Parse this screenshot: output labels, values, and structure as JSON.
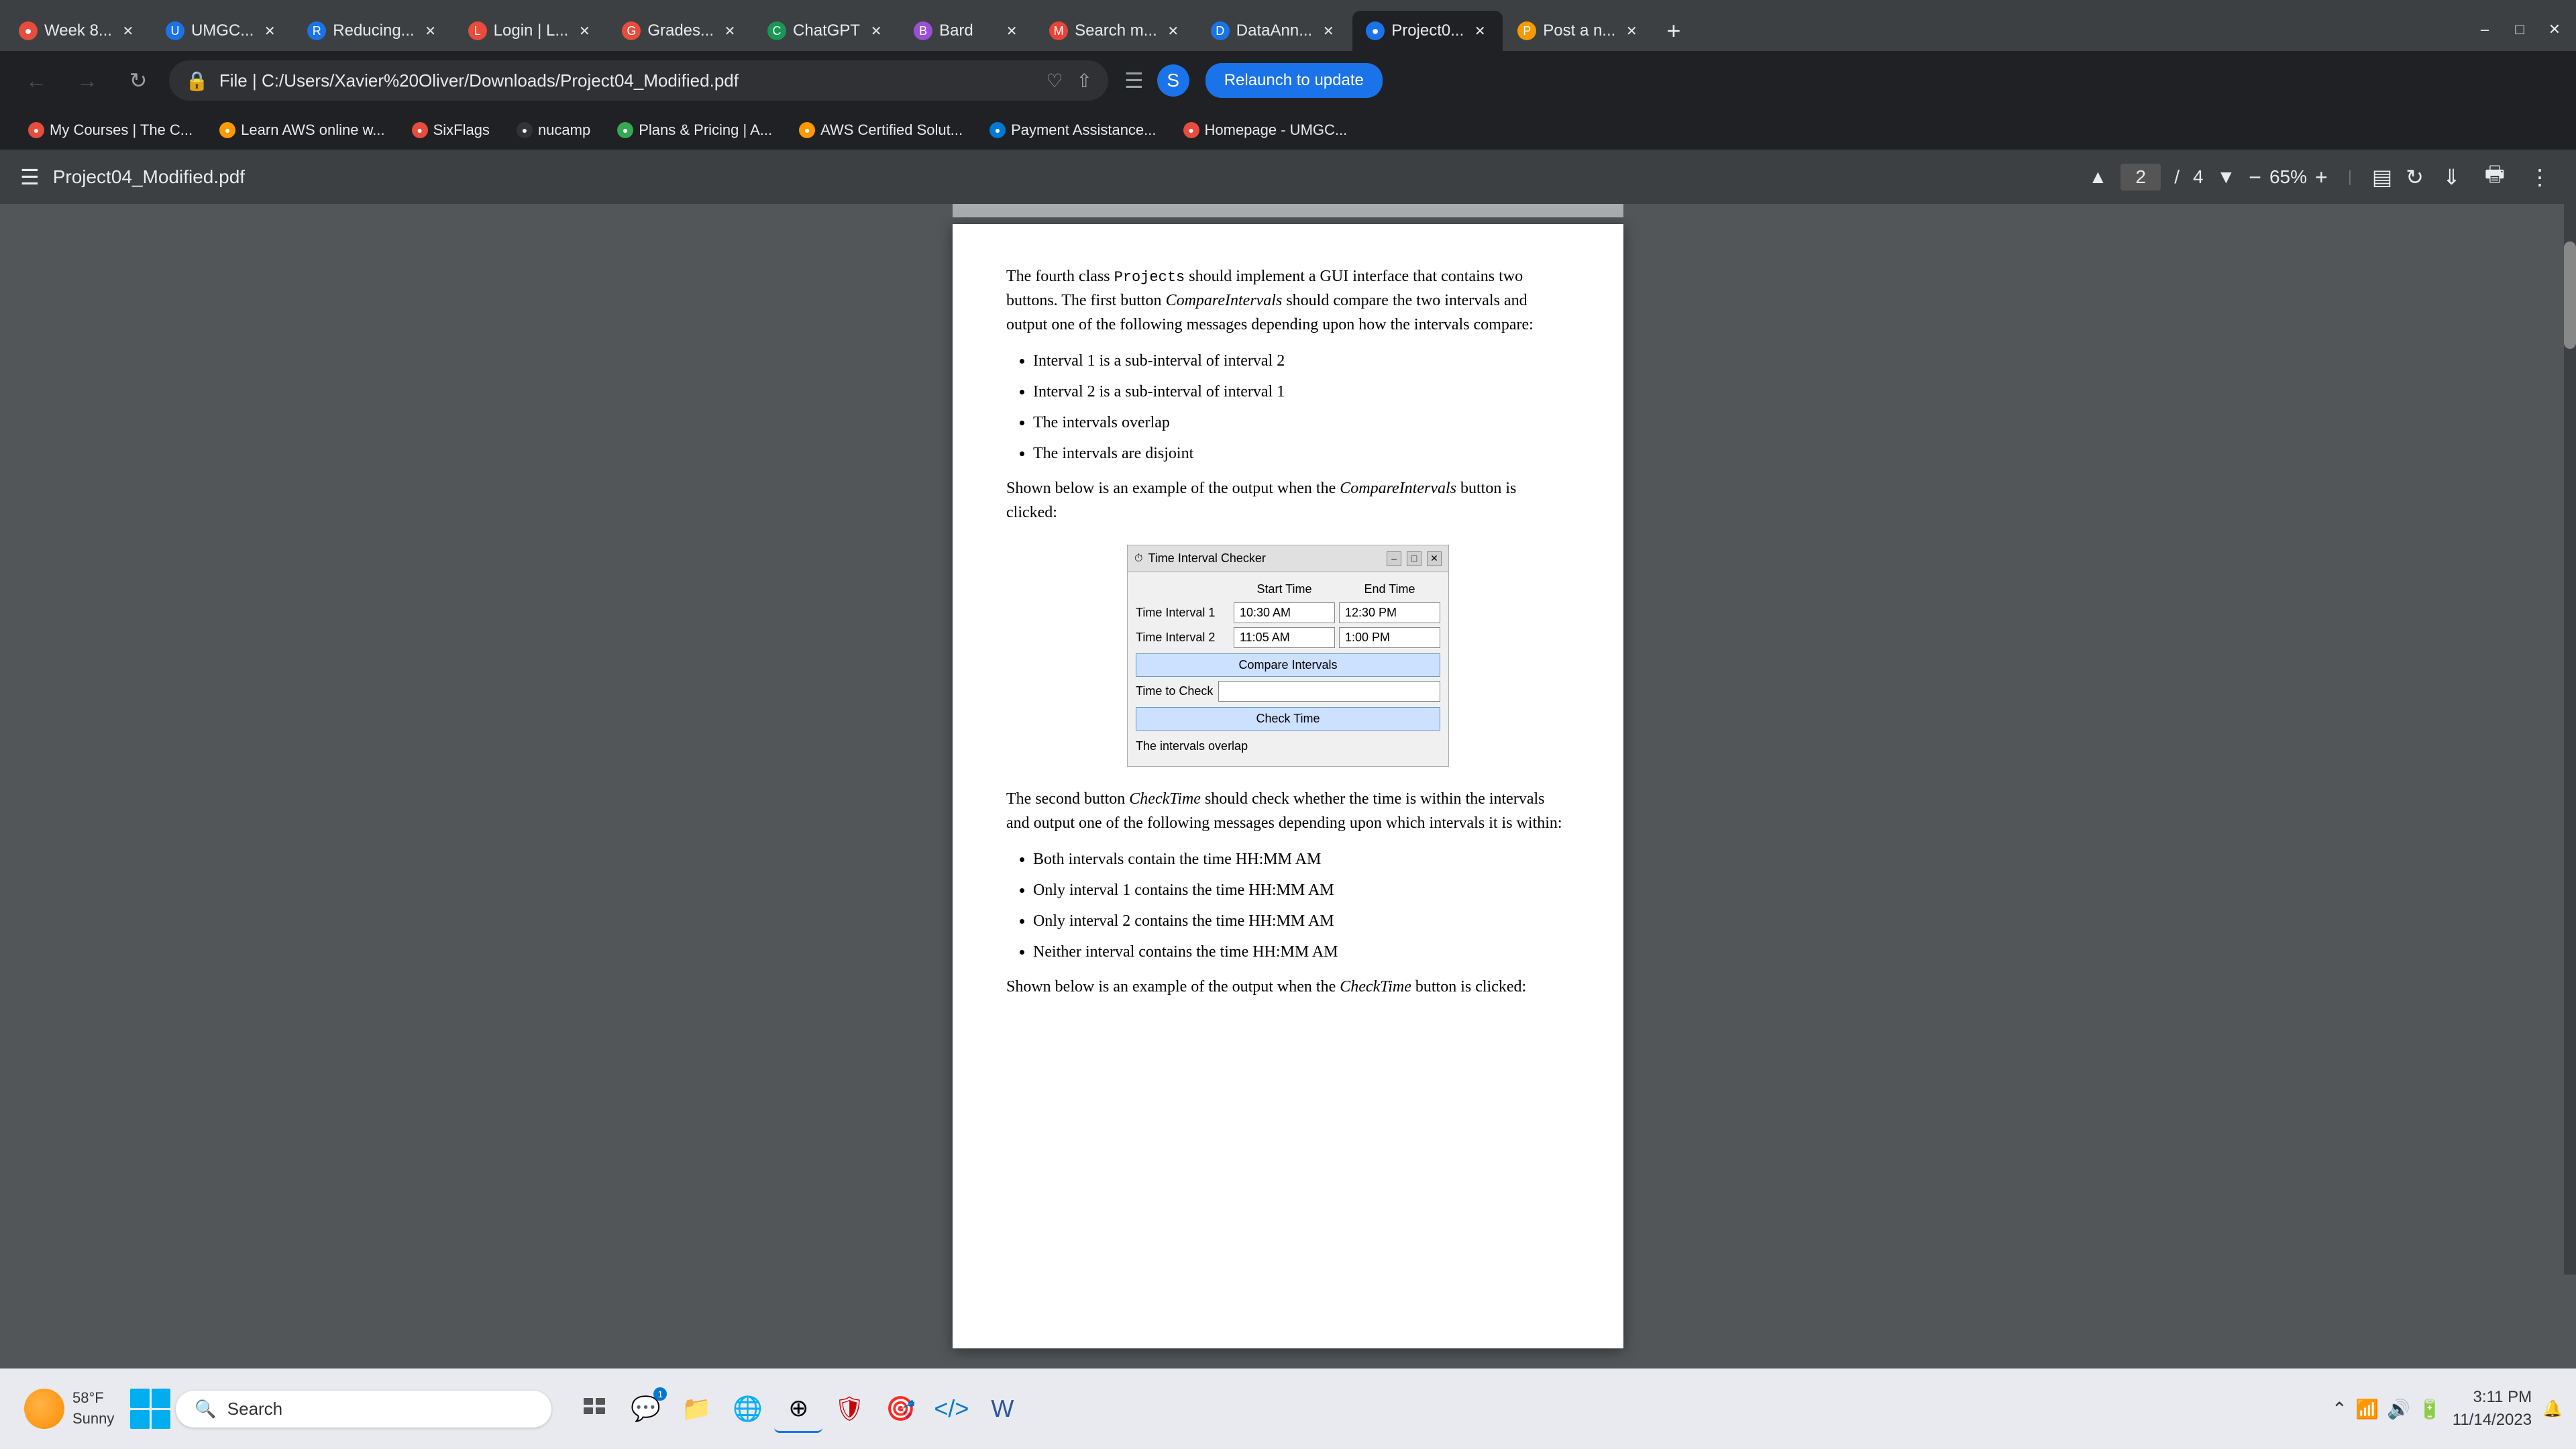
{
  "browser": {
    "tabs": [
      {
        "id": "week8",
        "label": "Week 8...",
        "favicon_color": "#e74c3c",
        "favicon_char": "●",
        "active": false
      },
      {
        "id": "umgc",
        "label": "UMGC...",
        "favicon_color": "#1a73e8",
        "favicon_char": "U",
        "active": false
      },
      {
        "id": "reducing",
        "label": "Reducing...",
        "favicon_color": "#1a73e8",
        "favicon_char": "R",
        "active": false
      },
      {
        "id": "login",
        "label": "Login | L...",
        "favicon_color": "#e74c3c",
        "favicon_char": "L",
        "active": false
      },
      {
        "id": "grades",
        "label": "Grades...",
        "favicon_color": "#e74c3c",
        "favicon_char": "G",
        "active": false
      },
      {
        "id": "chatgpt",
        "label": "ChatGPT",
        "favicon_color": "#1a9655",
        "favicon_char": "C",
        "active": false
      },
      {
        "id": "bard",
        "label": "Bard",
        "favicon_color": "#9c4fd6",
        "favicon_char": "B",
        "active": false
      },
      {
        "id": "search_mail",
        "label": "Search m...",
        "favicon_color": "#ea4335",
        "favicon_char": "M",
        "active": false
      },
      {
        "id": "dataann",
        "label": "DataAnn...",
        "favicon_color": "#1a73e8",
        "favicon_char": "D",
        "active": false
      },
      {
        "id": "project0",
        "label": "Project0...",
        "favicon_color": "#1a73e8",
        "favicon_char": "●",
        "active": true
      },
      {
        "id": "post",
        "label": "Post a n...",
        "favicon_color": "#f59b00",
        "favicon_char": "P",
        "active": false
      }
    ],
    "address": {
      "icon": "🔒",
      "url": "File  |  C:/Users/Xavier%20Oliver/Downloads/Project04_Modified.pdf",
      "url_short": "File  |  C:/Users/Xavier%20Oliver/Downloads/Project04_Modified.pdf"
    },
    "relaunch_label": "Relaunch to update",
    "bookmarks": [
      {
        "label": "My Courses | The C...",
        "favicon_color": "#e74c3c"
      },
      {
        "label": "Learn AWS online w...",
        "favicon_color": "#f90"
      },
      {
        "label": "SixFlags",
        "favicon_color": "#e74c3c"
      },
      {
        "label": "nucamp",
        "favicon_color": "#333"
      },
      {
        "label": "Plans & Pricing | A...",
        "favicon_color": "#34a853"
      },
      {
        "label": "AWS Certified Solut...",
        "favicon_color": "#f90"
      },
      {
        "label": "Payment Assistance...",
        "favicon_color": "#0078d4"
      },
      {
        "label": "Homepage - UMGC...",
        "favicon_color": "#e74c3c"
      }
    ]
  },
  "pdf_viewer": {
    "title": "Project04_Modified.pdf",
    "current_page": "2",
    "total_pages": "4",
    "zoom": "65%"
  },
  "pdf_content": {
    "para1": "The fourth class Projects should implement a GUI interface that contains two buttons. The first button CompareIntervals should compare the two intervals and output one of the following messages depending upon how the intervals compare:",
    "bullet1": "Interval 1 is a sub-interval of interval 2",
    "bullet2": "Interval 2 is a sub-interval of interval 1",
    "bullet3": "The intervals overlap",
    "bullet4": "The intervals are disjoint",
    "shown_below_compare": "Shown below is an example of the output when the CompareIntervals button is clicked:",
    "widget_title": "Time Interval Checker",
    "widget_header_start": "Start Time",
    "widget_header_end": "End Time",
    "widget_label_interval1": "Time Interval 1",
    "widget_label_interval2": "Time Interval 2",
    "widget_val_start1": "10:30 AM",
    "widget_val_end1": "12:30 PM",
    "widget_val_start2": "11:05 AM",
    "widget_val_end2": "1:00 PM",
    "widget_compare_btn": "Compare Intervals",
    "widget_timetochecck_label": "Time to Check",
    "widget_check_btn": "Check Time",
    "widget_output": "The intervals overlap",
    "para2": "The second button CheckTime should check whether the time is within the intervals and output one of the following messages depending upon which intervals it is within:",
    "bullet5": "Both intervals contain the time HH:MM AM",
    "bullet6": "Only interval 1 contains the time HH:MM AM",
    "bullet7": "Only interval 2 contains the time HH:MM AM",
    "bullet8": "Neither interval contains the time HH:MM AM",
    "shown_below_check": "Shown below is an example of the output when the CheckTime button is clicked:"
  },
  "taskbar": {
    "weather_temp": "58°F",
    "weather_cond": "Sunny",
    "search_placeholder": "Search",
    "time": "3:11 PM",
    "date": "11/14/2023"
  }
}
